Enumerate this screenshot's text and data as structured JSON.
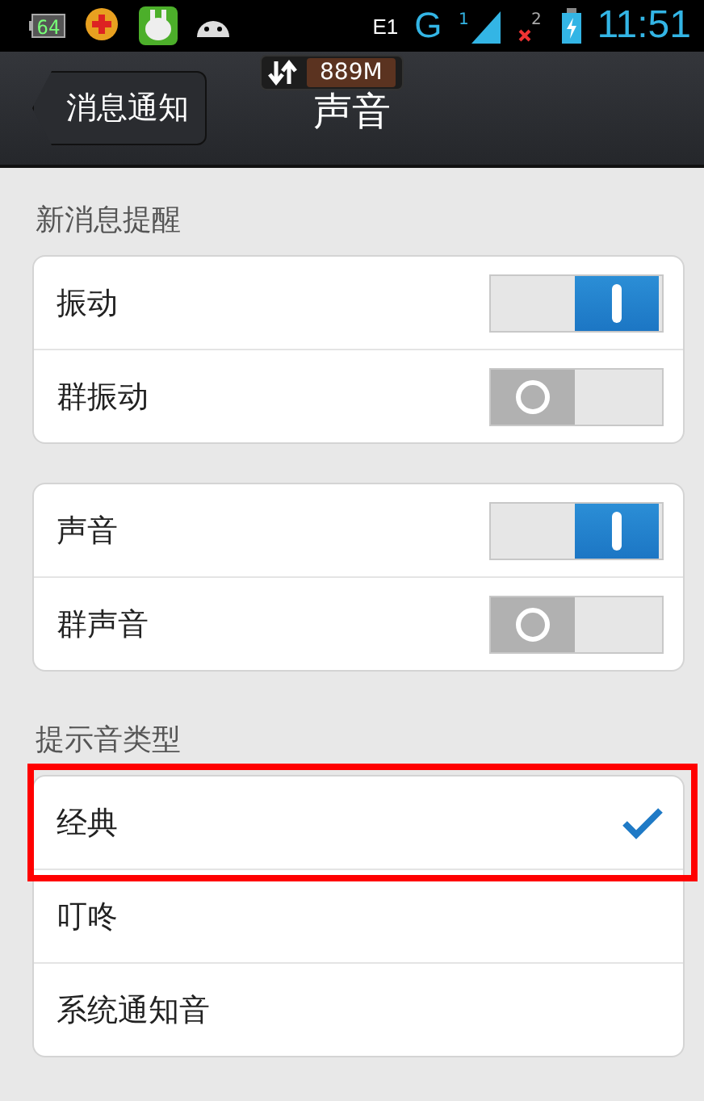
{
  "status_bar": {
    "notifications": [
      {
        "kind": "battery_app",
        "label": "64"
      },
      {
        "kind": "plus"
      },
      {
        "kind": "bunny"
      },
      {
        "kind": "android"
      }
    ],
    "data_label": "E1",
    "network": "G",
    "sim1": "1",
    "sim2": "2",
    "time": "11:51"
  },
  "traffic_widget": {
    "amount": "889M"
  },
  "header": {
    "back": "消息通知",
    "title": "声音"
  },
  "blocks": [
    {
      "kind": "label",
      "text": "新消息提醒"
    },
    {
      "kind": "switch_card",
      "rows": [
        {
          "label": "振动",
          "on": true
        },
        {
          "label": "群振动",
          "on": false
        }
      ]
    },
    {
      "kind": "switch_card",
      "rows": [
        {
          "label": "声音",
          "on": true
        },
        {
          "label": "群声音",
          "on": false
        }
      ]
    },
    {
      "kind": "label",
      "text": "提示音类型"
    },
    {
      "kind": "choice_card",
      "rows": [
        {
          "label": "经典",
          "selected": true,
          "highlighted": true
        },
        {
          "label": "叮咚",
          "selected": false,
          "highlighted": false
        },
        {
          "label": "系统通知音",
          "selected": false,
          "highlighted": false
        }
      ]
    }
  ]
}
